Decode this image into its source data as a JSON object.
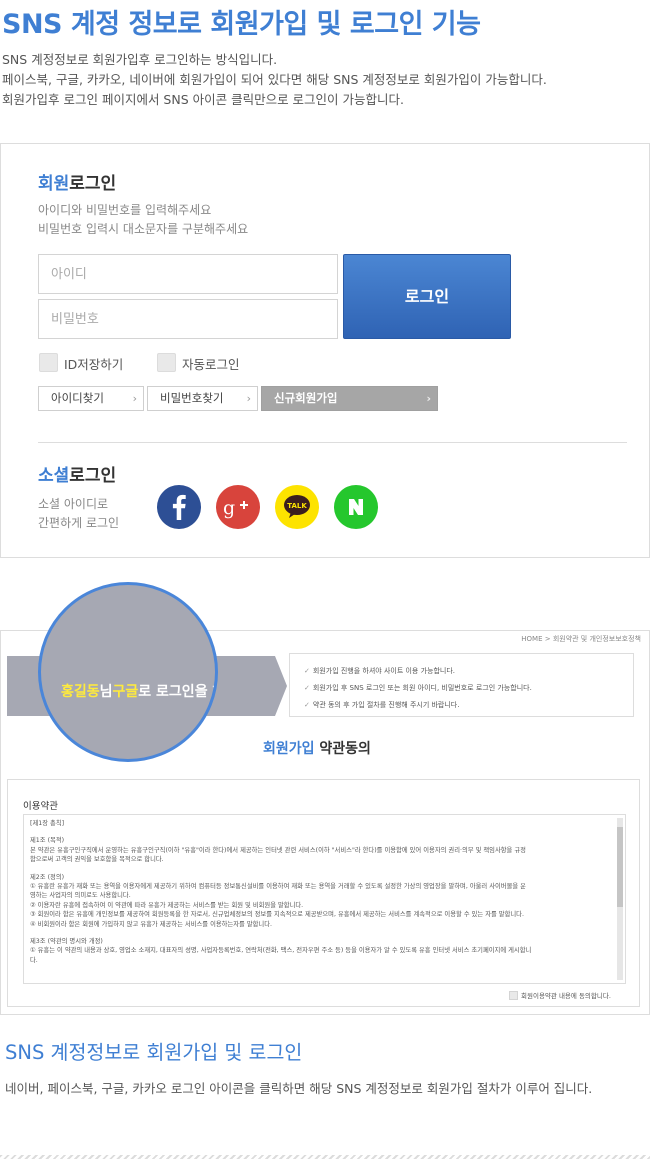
{
  "header": {
    "title": "SNS 계정 정보로 회원가입 및 로그인 기능",
    "desc": [
      "SNS 계정정보로 회원가입후 로그인하는 방식입니다.",
      "페이스북, 구글, 카카오, 네이버에 회원가입이 되어 있다면 해당 SNS 계정정보로 회원가입이 가능합니다.",
      "회원가입후 로그인 페이지에서 SNS 아이콘 클릭만으로 로그인이 가능합니다."
    ]
  },
  "login": {
    "title_a": "회원",
    "title_b": "로그인",
    "desc": [
      "아이디와 비밀번호를 입력해주세요",
      "비밀번호 입력시 대소문자를 구분해주세요"
    ],
    "id_placeholder": "아이디",
    "pw_placeholder": "비밀번호",
    "login_button": "로그인",
    "save_id": "ID저장하기",
    "auto_login": "자동로그인",
    "find_id": "아이디찾기",
    "find_pw": "비밀번호찾기",
    "signup": "신규회원가입",
    "arrow": "›"
  },
  "social": {
    "title_a": "소셜",
    "title_b": "로그인",
    "desc": [
      "소셜 아이디로",
      "간편하게 로그인"
    ],
    "icons": [
      "facebook-icon",
      "google-plus-icon",
      "kakao-talk-icon",
      "naver-icon"
    ],
    "colors": {
      "facebook": "#2d4f95",
      "google": "#d8443c",
      "kakao": "#fde300",
      "naver": "#25c72d"
    }
  },
  "preview": {
    "breadcrumb": "HOME  >  회원약관 및 개인정보보호정책",
    "notices": [
      "회원가입 진행을 하셔야 사이트 이용 가능합니다.",
      "회원가입 후 SNS 로그인 또는 회원 아이디, 비밀번호로 로그인 가능합니다.",
      "약관 동의 후 가입 절차를 진행해 주시기 바랍니다."
    ],
    "title_a": "회원가입",
    "title_b": " 약관동의",
    "terms_title": "이용약관",
    "terms_lines": [
      "[제1장  총칙]",
      "",
      "제1조 (목적)",
      "본 약관은 유흥구인구직에서 운영하는 유흥구인구직(이하 \"유흥\"이라 한다)에서 제공하는 인터넷 관련 서비스(이하 \"서비스\"라 한다)를 이용함에 있어 이용자의 권리·의무 및 책임사항을 규정",
      "함으로써 고객의 권익을 보호함을 목적으로 합니다.",
      "",
      "제2조 (정의)",
      "① 유흥란 유흥가 재화 또는 용역을 이용자에게 제공하기 위하여 컴퓨터등 정보통신설비를 이용하여 재화 또는 용역을 거래할 수 있도록 설정한 가상의 영업장을 말하며, 아울러 사이버몰을 운",
      "영하는 사업자의 의미로도 사용합니다.",
      "② 이용자란 유흥에 접속하여 이 약관에 따라 유흥가 제공하는 서비스를 받는 회원 및 비회원을 말합니다.",
      "③ 회원이라 함은 유흥에 개인정보를 제공하여 회원등록을 한 자로서, 신규업체정보의 정보를 지속적으로 제공받으며, 유흥에서 제공하는 서비스를 계속적으로 이용할 수 있는 자를 말합니다.",
      "④ 비회원이라 함은 회원에 가입하지 않고 유흥가 제공하는 서비스를 이용하는자를 말합니다.",
      "",
      "제3조 (약관의 명시와 개정)",
      "① 유흥는 이 약관의 내용과 상호, 영업소 소재지, 대표자의 성명, 사업자등록번호, 연락처(전화, 팩스, 전자우편 주소 등) 등을 이용자가 알 수 있도록 유흥 인터넷 서비스 초기페이지에 게시합니",
      "다."
    ],
    "agree": "회원이용약관 내용에 동의합니다.",
    "magnifier": {
      "name": "홍길동",
      "a": "님",
      "b": "구글",
      "c": "로 로그인을 하"
    }
  },
  "footer": {
    "title": "SNS 계정정보로 회원가입 및 로그인",
    "text": "네이버, 페이스북, 구글, 카카오 로그인 아이콘을 클릭하면 해당 SNS 계정정보로 회원가입 절차가 이루어 집니다."
  }
}
